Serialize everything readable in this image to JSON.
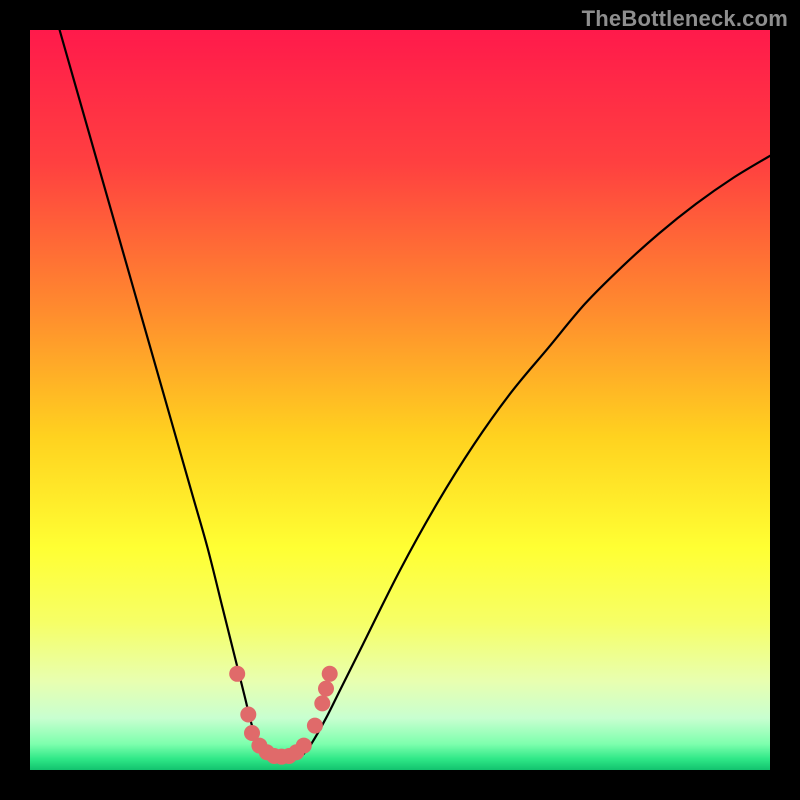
{
  "watermark": "TheBottleneck.com",
  "chart_data": {
    "type": "line",
    "title": "",
    "xlabel": "",
    "ylabel": "",
    "xlim": [
      0,
      100
    ],
    "ylim": [
      0,
      100
    ],
    "background_gradient": {
      "stops": [
        {
          "offset": 0.0,
          "color": "#ff1a4b"
        },
        {
          "offset": 0.18,
          "color": "#ff4040"
        },
        {
          "offset": 0.38,
          "color": "#ff8c2e"
        },
        {
          "offset": 0.55,
          "color": "#ffd21f"
        },
        {
          "offset": 0.7,
          "color": "#ffff33"
        },
        {
          "offset": 0.8,
          "color": "#f6ff66"
        },
        {
          "offset": 0.88,
          "color": "#e8ffb0"
        },
        {
          "offset": 0.93,
          "color": "#c8ffd0"
        },
        {
          "offset": 0.965,
          "color": "#7dffad"
        },
        {
          "offset": 0.985,
          "color": "#2fe887"
        },
        {
          "offset": 1.0,
          "color": "#12c26e"
        }
      ]
    },
    "series": [
      {
        "name": "bottleneck-curve",
        "x": [
          4,
          6,
          8,
          10,
          12,
          14,
          16,
          18,
          20,
          22,
          24,
          26,
          27,
          28,
          29,
          30,
          31,
          32,
          33,
          34,
          35,
          36,
          37,
          38,
          40,
          42,
          45,
          50,
          55,
          60,
          65,
          70,
          75,
          80,
          85,
          90,
          95,
          100
        ],
        "y": [
          100,
          93,
          86,
          79,
          72,
          65,
          58,
          51,
          44,
          37,
          30,
          22,
          18,
          14,
          10,
          6,
          3.5,
          2.2,
          1.6,
          1.4,
          1.4,
          1.6,
          2.2,
          3.5,
          7,
          11,
          17,
          27,
          36,
          44,
          51,
          57,
          63,
          68,
          72.5,
          76.5,
          80,
          83
        ]
      }
    ],
    "markers": {
      "name": "highlight-dots",
      "color": "#e06a6a",
      "points": [
        {
          "x": 28.0,
          "y": 13.0
        },
        {
          "x": 29.5,
          "y": 7.5
        },
        {
          "x": 30.0,
          "y": 5.0
        },
        {
          "x": 31.0,
          "y": 3.3
        },
        {
          "x": 32.0,
          "y": 2.4
        },
        {
          "x": 33.0,
          "y": 1.9
        },
        {
          "x": 34.0,
          "y": 1.8
        },
        {
          "x": 35.0,
          "y": 1.9
        },
        {
          "x": 36.0,
          "y": 2.4
        },
        {
          "x": 37.0,
          "y": 3.3
        },
        {
          "x": 38.5,
          "y": 6.0
        },
        {
          "x": 39.5,
          "y": 9.0
        },
        {
          "x": 40.0,
          "y": 11.0
        },
        {
          "x": 40.5,
          "y": 13.0
        }
      ]
    }
  }
}
